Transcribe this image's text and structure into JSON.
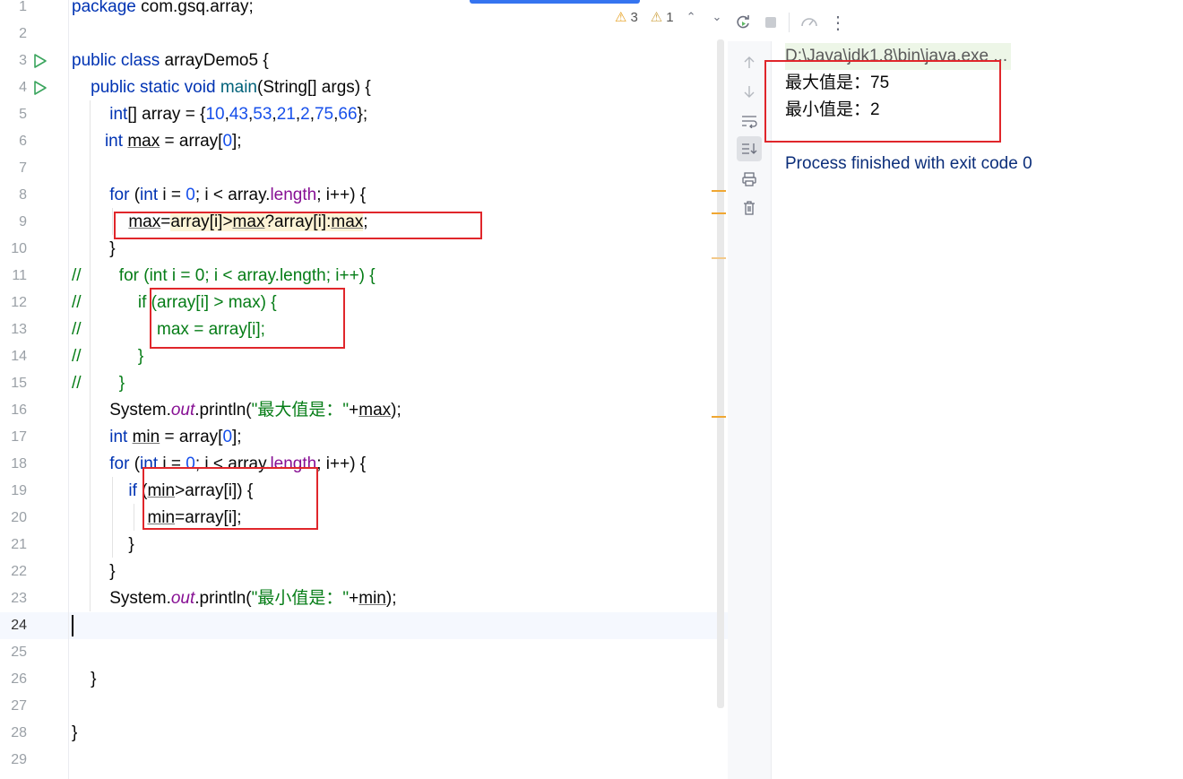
{
  "editor": {
    "lines": [
      {
        "n": "1",
        "html": "<span class=\"kw\">package</span> com.gsq.array;"
      },
      {
        "n": "2",
        "html": ""
      },
      {
        "n": "3",
        "run": true,
        "html": "<span class=\"kw\">public class</span> arrayDemo5 {"
      },
      {
        "n": "4",
        "run": true,
        "html": "    <span class=\"kw\">public static void</span> <span style=\"color:#00627a\">main</span>(String[] args) {"
      },
      {
        "n": "5",
        "html": "        <span class=\"kw\">int</span>[] array = {<span class=\"num\">10</span>,<span class=\"num\">43</span>,<span class=\"num\">53</span>,<span class=\"num\">21</span>,<span class=\"num\">2</span>,<span class=\"num\">75</span>,<span class=\"num\">66</span>};"
      },
      {
        "n": "6",
        "html": "       <span class=\"kw\">int</span> <span class=\"und\">max</span> = array[<span class=\"num\">0</span>];"
      },
      {
        "n": "7",
        "html": ""
      },
      {
        "n": "8",
        "html": "        <span class=\"kw\">for</span> (<span class=\"kw\">int</span> i = <span class=\"num\">0</span>; i &lt; array.<span class=\"fld\">length</span>; i++) {"
      },
      {
        "n": "9",
        "html": "            <span class=\"und\">max</span>=<span class=\"hl\">array[i]&gt;<span class=\"und\">max</span>?array[i]:<span class=\"und\">max</span></span>;"
      },
      {
        "n": "10",
        "html": "        }"
      },
      {
        "n": "11",
        "html": "<span class=\"cmt\">//        for (int i = 0; i &lt; array.length; i++) {</span>"
      },
      {
        "n": "12",
        "html": "<span class=\"cmt\">//            if (array[i] &gt; max) {</span>"
      },
      {
        "n": "13",
        "html": "<span class=\"cmt\">//                max = array[i];</span>"
      },
      {
        "n": "14",
        "html": "<span class=\"cmt\">//            }</span>"
      },
      {
        "n": "15",
        "html": "<span class=\"cmt\">//        }</span>"
      },
      {
        "n": "16",
        "html": "        System.<span class=\"out\">out</span>.println(<span class=\"str\">\"最大值是：\"</span>+<span class=\"und\">max</span>);"
      },
      {
        "n": "17",
        "html": "        <span class=\"kw\">int</span> <span class=\"und\">min</span> = array[<span class=\"num\">0</span>];"
      },
      {
        "n": "18",
        "html": "        <span class=\"kw\">for</span> (<span class=\"kw\">int</span> i = <span class=\"num\">0</span>; i &lt; array.<span class=\"fld\">length</span>; i++) {"
      },
      {
        "n": "19",
        "html": "            <span class=\"kw\">if</span> (<span class=\"und\">min</span>&gt;array[i]) {"
      },
      {
        "n": "20",
        "html": "                <span class=\"und\">min</span>=array[i];"
      },
      {
        "n": "21",
        "html": "            }"
      },
      {
        "n": "22",
        "html": "        }"
      },
      {
        "n": "23",
        "html": "        System.<span class=\"out\">out</span>.println(<span class=\"str\">\"最小值是：\"</span>+<span class=\"und\">min</span>);"
      },
      {
        "n": "24",
        "html": "",
        "current": true
      },
      {
        "n": "25",
        "html": ""
      },
      {
        "n": "26",
        "html": "    }"
      },
      {
        "n": "27",
        "html": ""
      },
      {
        "n": "28",
        "html": "}"
      },
      {
        "n": "29",
        "html": ""
      }
    ],
    "inspections": {
      "warnings": "3",
      "weak_warnings": "1"
    }
  },
  "console": {
    "command": "D:\\Java\\jdk1.8\\bin\\java.exe ...",
    "output": [
      "最大值是：75",
      "最小值是：2"
    ],
    "process": "Process finished with exit code 0"
  },
  "icons": {
    "run_gutter": "run-triangle-icon",
    "rerun": "rerun-icon",
    "stop": "stop-icon",
    "profiler": "gauge-icon",
    "more": "more-vertical-icon",
    "up": "arrow-up-icon",
    "down": "arrow-down-icon",
    "wrap": "soft-wrap-icon",
    "scroll_end": "scroll-to-end-icon",
    "print": "print-icon",
    "clear": "trash-icon"
  },
  "colors": {
    "keyword": "#0033b3",
    "number": "#1750eb",
    "comment": "#067d17",
    "annotation_box": "#e0262b"
  }
}
